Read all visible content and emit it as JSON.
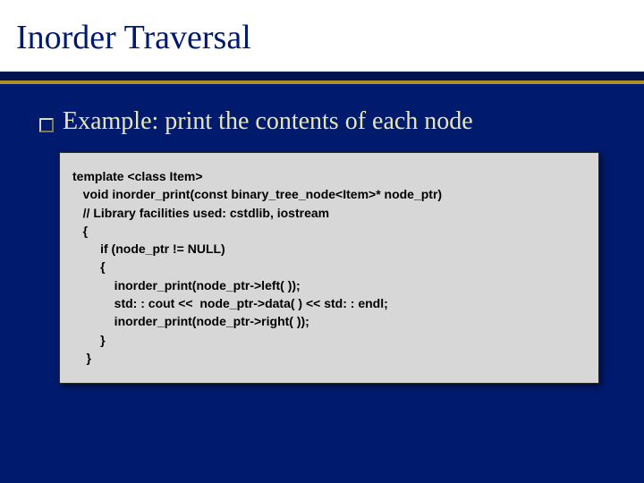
{
  "title": "Inorder Traversal",
  "bullet": {
    "label": "Example:",
    "text": " print the contents of each node"
  },
  "code": {
    "l1": "template <class Item>",
    "l2": "   void inorder_print(const binary_tree_node<Item>* node_ptr)",
    "l3": "   // Library facilities used: cstdlib, iostream",
    "l4": "   {",
    "l5": "        if (node_ptr != NULL)",
    "l6": "        {",
    "l7": "            inorder_print(node_ptr->left( ));",
    "l8": "            std: : cout <<  node_ptr->data( ) << std: : endl;",
    "l9": "            inorder_print(node_ptr->right( ));",
    "l10": "        }",
    "l11": "    }"
  }
}
